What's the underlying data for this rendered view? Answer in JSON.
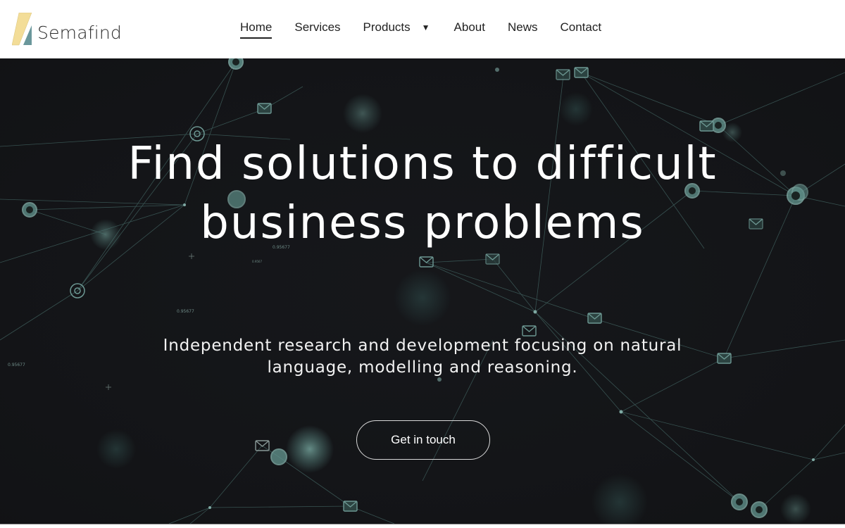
{
  "brand": {
    "name": "Semafind",
    "logo_colors": {
      "yellow": "#f3dd98",
      "teal": "#6a979b"
    }
  },
  "nav": {
    "items": [
      {
        "label": "Home",
        "active": true
      },
      {
        "label": "Services",
        "active": false
      },
      {
        "label": "Products",
        "active": false,
        "has_dropdown": true
      },
      {
        "label": "About",
        "active": false
      },
      {
        "label": "News",
        "active": false
      },
      {
        "label": "Contact",
        "active": false
      }
    ],
    "dropdown_icon": "caret-down-icon",
    "dropdown_glyph": "▼"
  },
  "hero": {
    "title_line1": "Find solutions to difficult",
    "title_line2": "business problems",
    "subtitle_line1": "Independent research and development focusing on natural",
    "subtitle_line2": "language, modelling and reasoning.",
    "cta_label": "Get in touch",
    "background_theme": "network graph with email and at-sign nodes",
    "background_number_labels": [
      "0.95677",
      "0.9567",
      "0.95677",
      "0.95677"
    ],
    "accent_color": "#5f8f89",
    "background_color": "#141518"
  }
}
